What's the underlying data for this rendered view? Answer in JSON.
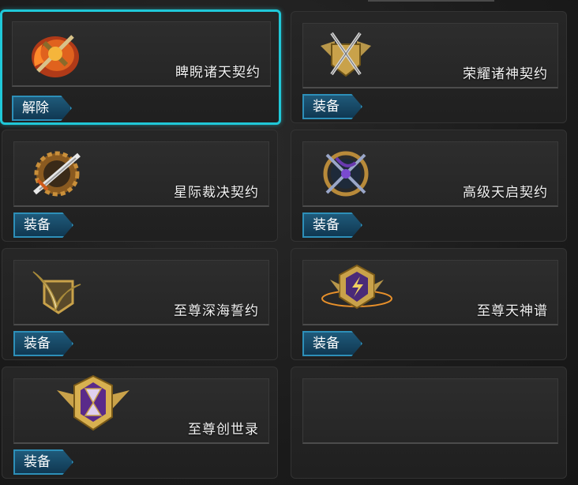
{
  "cards": [
    {
      "name": "睥睨诸天契约",
      "button": "解除",
      "selected": true,
      "icon": "flame-weapon-emblem-icon"
    },
    {
      "name": "荣耀诸神契约",
      "button": "装备",
      "selected": false,
      "icon": "crossed-swords-shield-icon"
    },
    {
      "name": "星际裁决契约",
      "button": "装备",
      "selected": false,
      "icon": "gear-blade-emblem-icon"
    },
    {
      "name": "高级天启契约",
      "button": "装备",
      "selected": false,
      "icon": "crossed-scythes-emblem-icon"
    },
    {
      "name": "至尊深海誓约",
      "button": "装备",
      "selected": false,
      "icon": "golden-wing-shield-icon"
    },
    {
      "name": "至尊天神谱",
      "button": "装备",
      "selected": false,
      "icon": "lightning-hexagon-emblem-icon"
    },
    {
      "name": "至尊创世录",
      "button": "装备",
      "selected": false,
      "icon": "hourglass-winged-emblem-icon"
    },
    {
      "name": "",
      "button": "",
      "selected": false,
      "icon": ""
    }
  ],
  "colors": {
    "selection": "#20c8d8",
    "button": "#1f5a7a",
    "gold": "#c9a24a"
  }
}
